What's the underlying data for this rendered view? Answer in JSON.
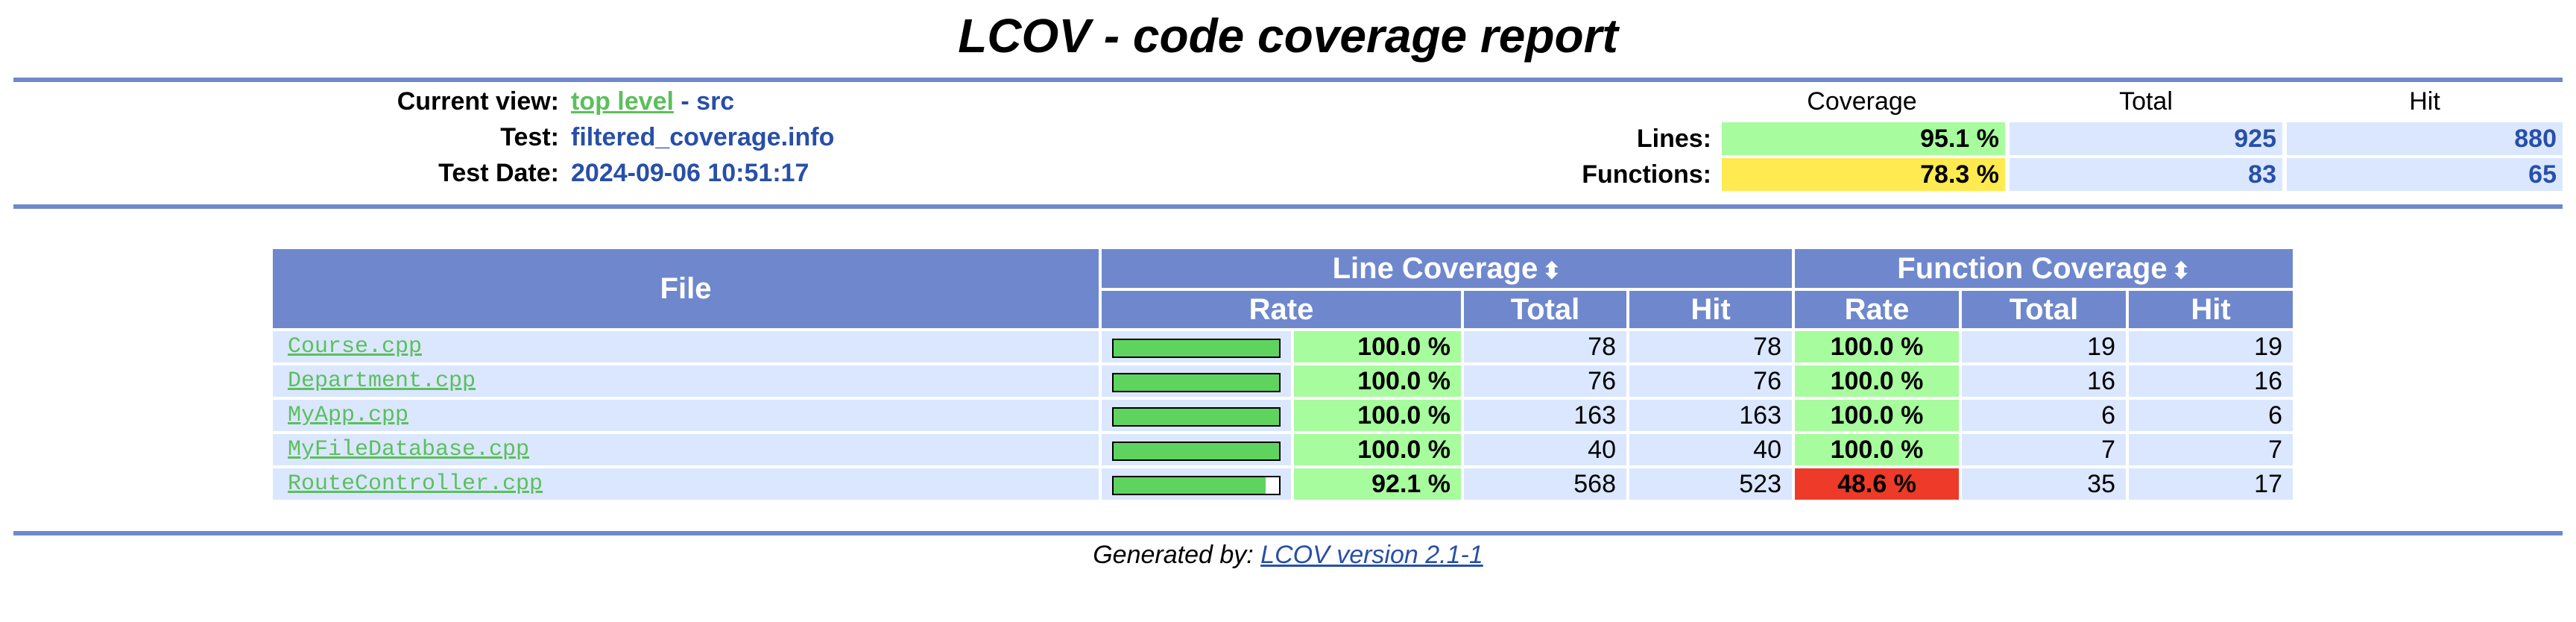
{
  "title": "LCOV - code coverage report",
  "header": {
    "current_view_label": "Current view:",
    "current_view_link": "top level",
    "current_view_sep": " - ",
    "current_view_dir": "src",
    "test_label": "Test:",
    "test_value": "filtered_coverage.info",
    "date_label": "Test Date:",
    "date_value": "2024-09-06 10:51:17"
  },
  "summary": {
    "col_coverage": "Coverage",
    "col_total": "Total",
    "col_hit": "Hit",
    "lines": {
      "label": "Lines:",
      "rate": "95.1 %",
      "total": "925",
      "hit": "880",
      "color": "#a7fc9d"
    },
    "functions": {
      "label": "Functions:",
      "rate": "78.3 %",
      "total": "83",
      "hit": "65",
      "color": "#ffea50"
    }
  },
  "table": {
    "col_file": "File",
    "col_line_cov": "Line Coverage",
    "col_func_cov": "Function Coverage",
    "col_rate": "Rate",
    "col_total": "Total",
    "col_hit": "Hit",
    "sort_icon": "sort-updown-icon",
    "rows": [
      {
        "file": "Course.cpp",
        "line_fraction": 1.0,
        "line_rate": "100.0 %",
        "line_total": "78",
        "line_hit": "78",
        "func_rate": "100.0 %",
        "func_total": "19",
        "func_hit": "19"
      },
      {
        "file": "Department.cpp",
        "line_fraction": 1.0,
        "line_rate": "100.0 %",
        "line_total": "76",
        "line_hit": "76",
        "func_rate": "100.0 %",
        "func_total": "16",
        "func_hit": "16"
      },
      {
        "file": "MyApp.cpp",
        "line_fraction": 1.0,
        "line_rate": "100.0 %",
        "line_total": "163",
        "line_hit": "163",
        "func_rate": "100.0 %",
        "func_total": "6",
        "func_hit": "6"
      },
      {
        "file": "MyFileDatabase.cpp",
        "line_fraction": 1.0,
        "line_rate": "100.0 %",
        "line_total": "40",
        "line_hit": "40",
        "func_rate": "100.0 %",
        "func_total": "7",
        "func_hit": "7"
      },
      {
        "file": "RouteController.cpp",
        "line_fraction": 0.921,
        "line_rate": "92.1 %",
        "line_total": "568",
        "line_hit": "523",
        "func_rate": "48.6 %",
        "func_total": "35",
        "func_hit": "17"
      }
    ]
  },
  "footer": {
    "prefix": "Generated by: ",
    "link": "LCOV version 2.1-1"
  },
  "colors": {
    "rule": "#6f88cd",
    "good": "#a7fc9d",
    "medium": "#ffea50",
    "bad": "#ee3a28",
    "cell": "#dae7fe",
    "link": "#5cbf5c"
  }
}
